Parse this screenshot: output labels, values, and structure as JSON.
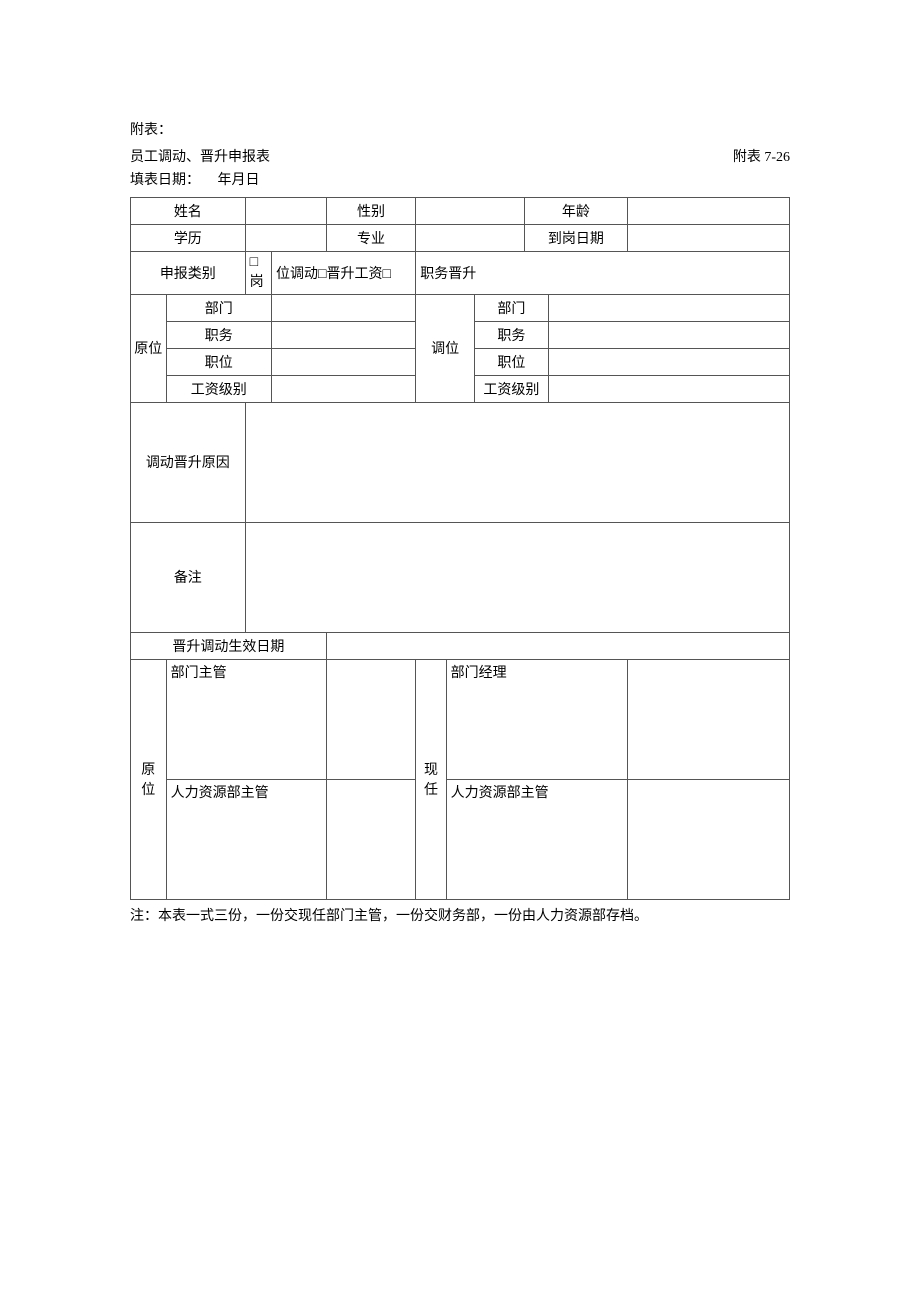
{
  "header": {
    "attachment_label": "附表：",
    "form_title": "员工调动、晋升申报表",
    "table_no": "附表 7-26",
    "fill_date_label": "填表日期：",
    "fill_date_format": "年月日"
  },
  "row1": {
    "name_label": "姓名",
    "name_value": "",
    "gender_label": "性别",
    "gender_value": "",
    "age_label": "年龄",
    "age_value": ""
  },
  "row2": {
    "education_label": "学历",
    "education_value": "",
    "major_label": "专业",
    "major_value": "",
    "arrival_date_label": "到岗日期",
    "arrival_date_value": ""
  },
  "row3": {
    "apply_type_label": "申报类别",
    "option_transfer": "□岗",
    "option_middle": "位调动□晋升工资□",
    "option_promotion": "职务晋升"
  },
  "original": {
    "group_label": "原位",
    "dept_label": "部门",
    "dept_value": "",
    "post_label": "职务",
    "post_value": "",
    "position_label": "职位",
    "position_value": "",
    "salary_level_label": "工资级别",
    "salary_level_value": ""
  },
  "current": {
    "group_label": "调位",
    "dept_label": "部门",
    "dept_value": "",
    "post_label": "职务",
    "post_value": "",
    "position_label": "职位",
    "position_value": "",
    "salary_level_label": "工资级别",
    "salary_level_value": ""
  },
  "reason": {
    "label": "调动晋升原因",
    "value": ""
  },
  "remark": {
    "label": "备注",
    "value": ""
  },
  "effective": {
    "label": "晋升调动生效日期",
    "value": ""
  },
  "signatures": {
    "orig_group_label": "原位",
    "orig_dept_head_label": "部门主管",
    "orig_dept_head_value": "",
    "orig_hr_head_label": "人力资源部主管",
    "orig_hr_head_value": "",
    "new_group_label": "现任",
    "new_dept_mgr_label": "部门经理",
    "new_dept_mgr_value": "",
    "new_hr_head_label": "人力资源部主管",
    "new_hr_head_value": ""
  },
  "footer": {
    "note": "注：本表一式三份，一份交现任部门主管，一份交财务部，一份由人力资源部存档。"
  }
}
